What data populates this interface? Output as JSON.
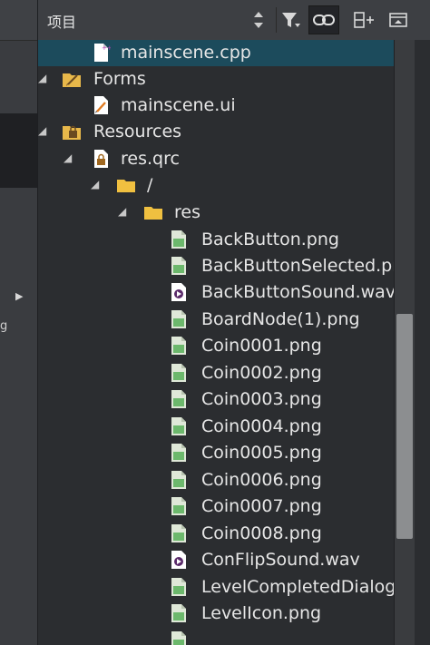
{
  "header": {
    "title": "项目",
    "buttons": [
      "filter-icon",
      "link-icon",
      "split-add-icon",
      "close-panel-icon"
    ]
  },
  "left_strip": {
    "fragment_text": "g"
  },
  "tree": [
    {
      "label": "mainscene.cpp",
      "icon": "cpp-file-icon",
      "selected": true
    },
    {
      "label": "Forms",
      "icon": "forms-folder-icon",
      "expanded": true
    },
    {
      "label": "mainscene.ui",
      "icon": "ui-file-icon"
    },
    {
      "label": "Resources",
      "icon": "resources-folder-icon",
      "expanded": true
    },
    {
      "label": "res.qrc",
      "icon": "qrc-file-icon",
      "expanded": true
    },
    {
      "label": "/",
      "icon": "folder-icon",
      "expanded": true
    },
    {
      "label": "res",
      "icon": "folder-icon",
      "expanded": true
    },
    {
      "label": "BackButton.png",
      "icon": "png-file-icon"
    },
    {
      "label": "BackButtonSelected.pn",
      "icon": "png-file-icon"
    },
    {
      "label": "BackButtonSound.wav",
      "icon": "wav-file-icon"
    },
    {
      "label": "BoardNode(1).png",
      "icon": "png-file-icon"
    },
    {
      "label": "Coin0001.png",
      "icon": "png-file-icon"
    },
    {
      "label": "Coin0002.png",
      "icon": "png-file-icon"
    },
    {
      "label": "Coin0003.png",
      "icon": "png-file-icon"
    },
    {
      "label": "Coin0004.png",
      "icon": "png-file-icon"
    },
    {
      "label": "Coin0005.png",
      "icon": "png-file-icon"
    },
    {
      "label": "Coin0006.png",
      "icon": "png-file-icon"
    },
    {
      "label": "Coin0007.png",
      "icon": "png-file-icon"
    },
    {
      "label": "Coin0008.png",
      "icon": "png-file-icon"
    },
    {
      "label": "ConFlipSound.wav",
      "icon": "wav-file-icon"
    },
    {
      "label": "LevelCompletedDialog",
      "icon": "png-file-icon"
    },
    {
      "label": "LevelIcon.png",
      "icon": "png-file-icon"
    }
  ]
}
